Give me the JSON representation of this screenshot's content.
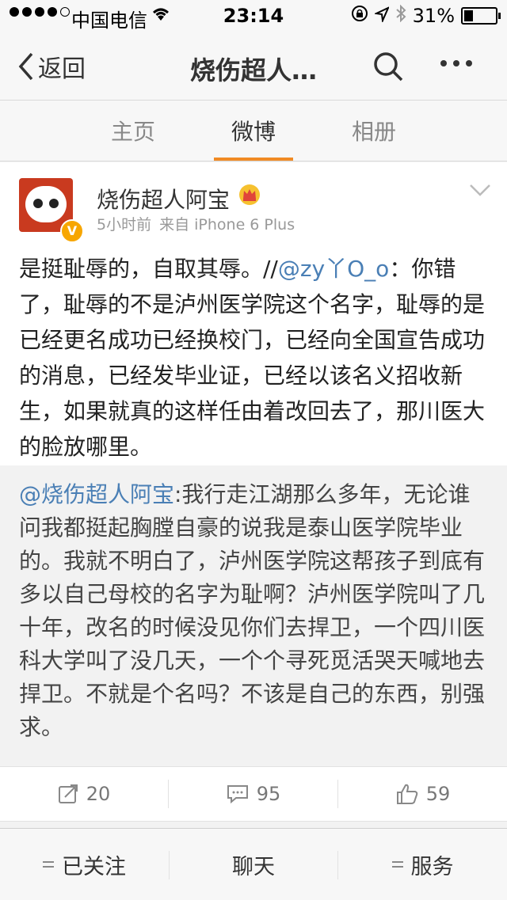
{
  "status_bar": {
    "carrier": "中国电信",
    "time": "23:14",
    "battery": "31%",
    "battery_level": 0.31
  },
  "nav": {
    "back_label": "返回",
    "title": "烧伤超人…"
  },
  "tabs": [
    {
      "label": "主页",
      "active": false
    },
    {
      "label": "微博",
      "active": true
    },
    {
      "label": "相册",
      "active": false
    }
  ],
  "post": {
    "author": "烧伤超人阿宝",
    "time": "5小时前",
    "source": "来自 iPhone 6 Plus",
    "text_before_mention": "是挺耻辱的，自取其辱。//",
    "mention": "@zy丫O_o",
    "text_after_mention": "：你错了，耻辱的不是泸州医学院这个名字，耻辱的是已经更名成功已经换校门，已经向全国宣告成功的消息，已经发毕业证，已经以该名义招收新生，如果就真的这样任由着改回去了，那川医大的脸放哪里。",
    "repost": {
      "mention": "@烧伤超人阿宝",
      "text": ":我行走江湖那么多年，无论谁问我都挺起胸膛自豪的说我是泰山医学院毕业的。我就不明白了，泸州医学院这帮孩子到底有多以自己母校的名字为耻啊？泸州医学院叫了几十年，改名的时候没见你们去捍卫，一个四川医科大学叫了没几天，一个个寻死觅活哭天喊地去捍卫。不就是个名吗？不该是自己的东西，别强求。"
    },
    "actions": {
      "repost_count": "20",
      "comment_count": "95",
      "like_count": "59"
    }
  },
  "bottom_bar": {
    "follow_label": "已关注",
    "chat_label": "聊天",
    "service_label": "服务"
  },
  "colors": {
    "accent": "#f08a24",
    "link": "#4a7fb5"
  }
}
